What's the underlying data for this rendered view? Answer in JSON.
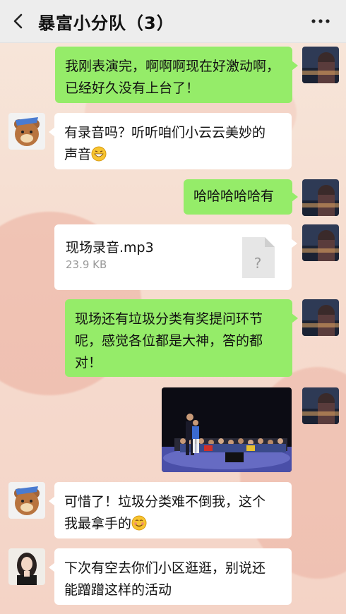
{
  "header": {
    "title": "暴富小分队（3）",
    "back_icon": "chevron-left-icon",
    "more_icon": "more-dots-icon"
  },
  "messages": [
    {
      "side": "right",
      "type": "text",
      "lines": [
        "我刚表演完，啊啊啊现在好激动啊，",
        "已经好久没有上台了！"
      ]
    },
    {
      "side": "left",
      "type": "text",
      "lines": [
        "有录音吗？听听咱们小云云美妙的",
        "声音"
      ],
      "emoji": "grin-emoji"
    },
    {
      "side": "right",
      "type": "text",
      "lines": [
        "哈哈哈哈哈有"
      ]
    },
    {
      "side": "right",
      "type": "file",
      "file_name": "现场录音.mp3",
      "file_size": "23.9 KB",
      "file_icon_glyph": "?"
    },
    {
      "side": "right",
      "type": "text",
      "lines": [
        "现场还有垃圾分类有奖提问环节",
        "呢，感觉各位都是大神，答的都",
        "对！"
      ]
    },
    {
      "side": "right",
      "type": "image",
      "description_icon": "stage-photo"
    },
    {
      "side": "left",
      "type": "text",
      "lines": [
        "可惜了！垃圾分类难不倒我，这个",
        "我最拿手的"
      ],
      "emoji": "smile-emoji"
    },
    {
      "side": "left",
      "type": "text",
      "lines": [
        "下次有空去你们小区逛逛，别说还",
        "能蹭蹭这样的活动"
      ]
    }
  ],
  "colors": {
    "header_bg": "#ededed",
    "bubble_self": "#95ec69",
    "bubble_other": "#ffffff"
  }
}
